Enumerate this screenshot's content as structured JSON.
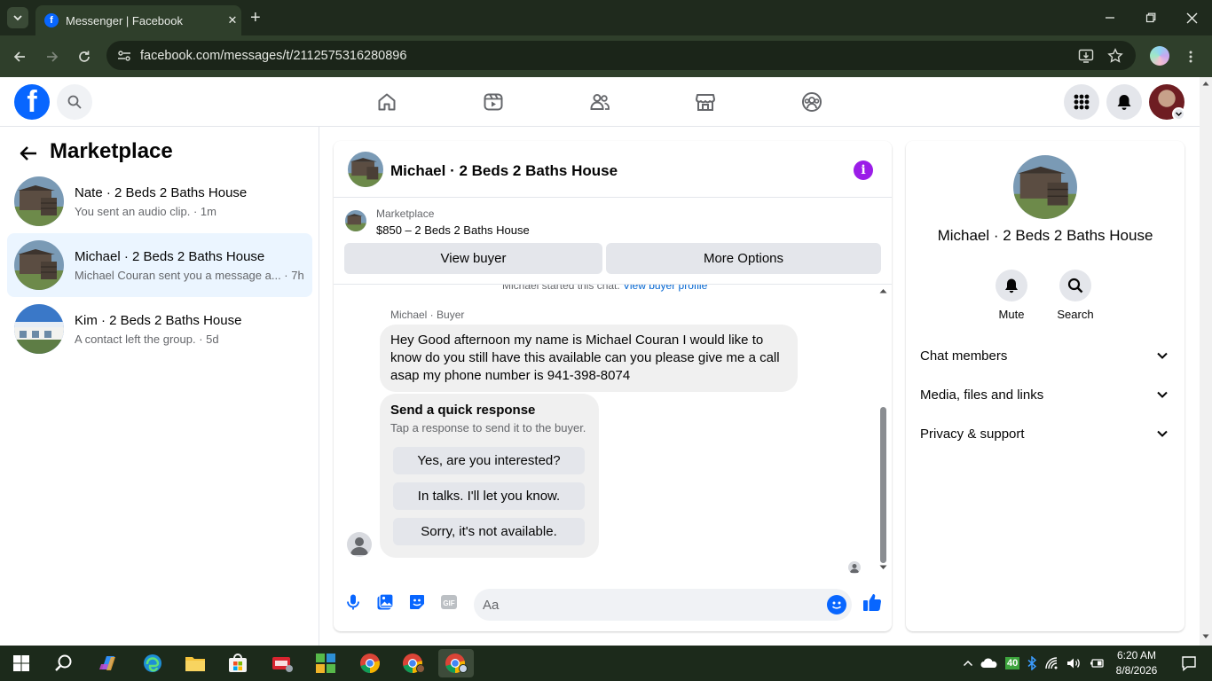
{
  "browser": {
    "tab_title": "Messenger | Facebook",
    "tab_close": "✕",
    "new_tab": "+",
    "url": "facebook.com/messages/t/2112575316280896"
  },
  "fb_header": {
    "logo": "f",
    "nav_icons": [
      "home-icon",
      "watch-icon",
      "friends-icon",
      "marketplace-icon",
      "groups-icon"
    ],
    "brand_color": "#0866ff"
  },
  "left_panel": {
    "title": "Marketplace",
    "conversations": [
      {
        "name": "Nate · 2 Beds 2 Baths House",
        "preview": "You sent an audio clip. · 1m"
      },
      {
        "name": "Michael · 2 Beds 2 Baths House",
        "preview": "Michael Couran sent you a message a... · 7h"
      },
      {
        "name": "Kim · 2 Beds 2 Baths House",
        "preview": "A contact left the group. · 5d"
      }
    ]
  },
  "chat": {
    "title": "Michael · 2 Beds 2 Baths House",
    "info_icon": "i",
    "marketplace_label": "Marketplace",
    "listing": "$850 – 2 Beds 2 Baths House",
    "view_buyer": "View buyer",
    "more_options": "More Options",
    "started_text": "Michael started this chat.",
    "view_buyer_profile": "View buyer profile",
    "sender_label": "Michael · Buyer",
    "message": "Hey Good afternoon my name is Michael Couran I would like to know do you still have this available can you please give me a call asap my phone number is 941-398-8074",
    "quick_title": "Send a quick response",
    "quick_sub": "Tap a response to send it to the buyer.",
    "quick_replies": [
      "Yes, are you interested?",
      "In talks. I'll let you know.",
      "Sorry, it's not available."
    ],
    "input_placeholder": "Aa",
    "accent": "#0866ff"
  },
  "right_panel": {
    "name": "Michael · 2 Beds 2 Baths House",
    "mute": "Mute",
    "search": "Search",
    "sections": [
      "Chat members",
      "Media, files and links",
      "Privacy & support"
    ]
  },
  "taskbar": {
    "weather": "40",
    "time": "6:20 AM",
    "date": "8/8/2026"
  }
}
